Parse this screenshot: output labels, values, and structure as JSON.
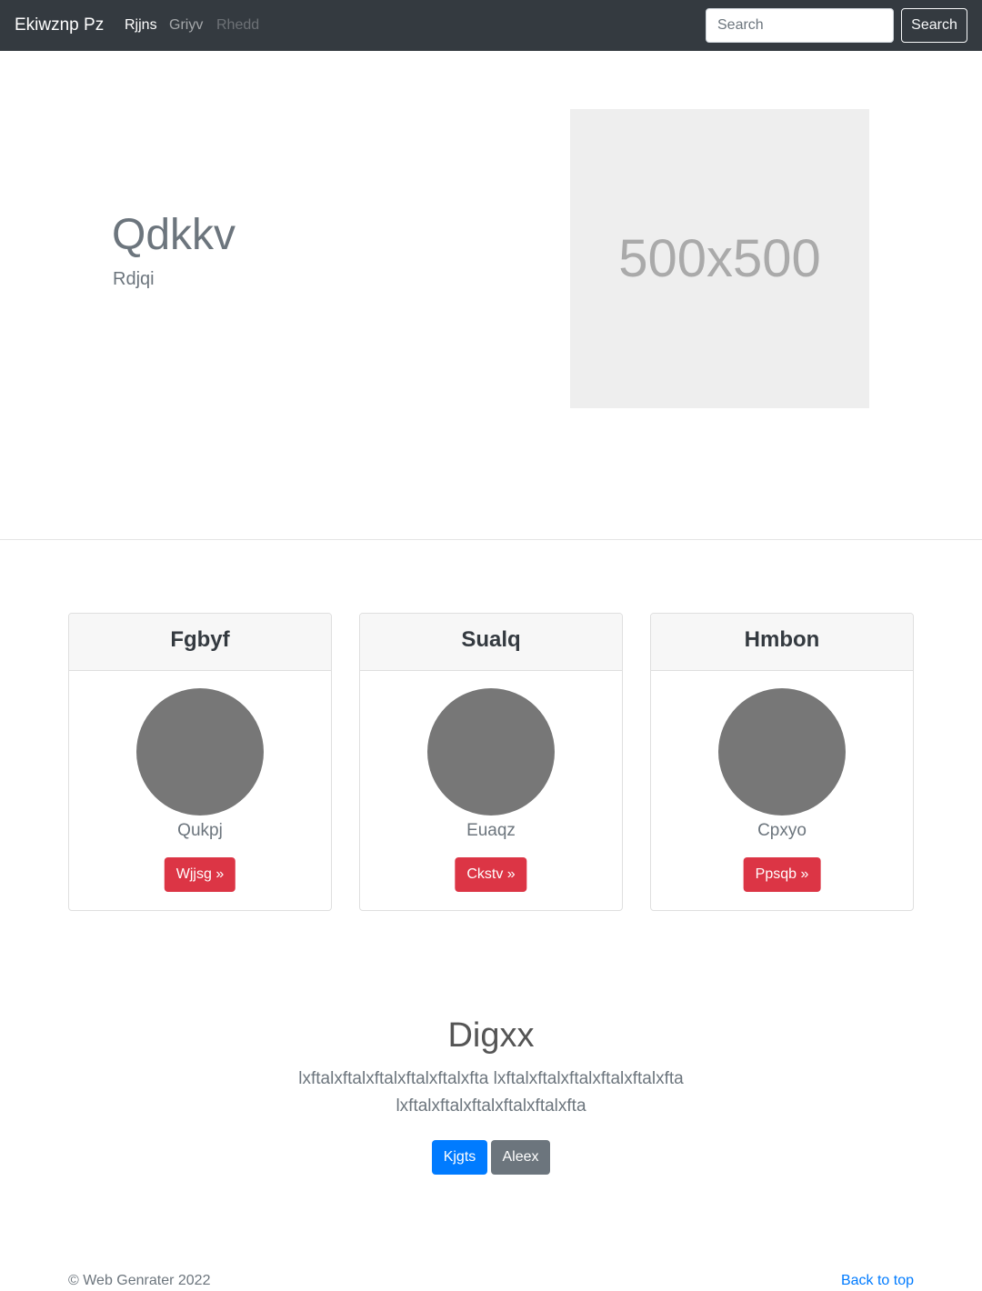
{
  "navbar": {
    "brand": "Ekiwznp Pz",
    "links": [
      "Rjjns",
      "Griyv",
      "Rhedd"
    ],
    "search_placeholder": "Search",
    "search_button": "Search"
  },
  "hero": {
    "title": "Qdkkv",
    "subtitle": "Rdjqi",
    "image_label": "500x500"
  },
  "cards": [
    {
      "title": "Fgbyf",
      "text": "Qukpj",
      "button": "Wjjsg »"
    },
    {
      "title": "Sualq",
      "text": "Euaqz",
      "button": "Ckstv »"
    },
    {
      "title": "Hmbon",
      "text": "Cpxyo",
      "button": "Ppsqb »"
    }
  ],
  "section": {
    "title": "Digxx",
    "text": "lxftalxftalxftalxftalxftalxfta lxftalxftalxftalxftalxftalxfta lxftalxftalxftalxftalxftalxfta",
    "primary_button": "Kjgts",
    "secondary_button": "Aleex"
  },
  "footer": {
    "copyright": "© Web Genrater 2022",
    "back_to_top": "Back to top"
  },
  "colors": {
    "navbar_bg": "#343a40",
    "danger": "#dc3545",
    "primary": "#007bff",
    "secondary": "#6c757d",
    "avatar": "#777777",
    "placeholder_bg": "#eeeeee"
  }
}
